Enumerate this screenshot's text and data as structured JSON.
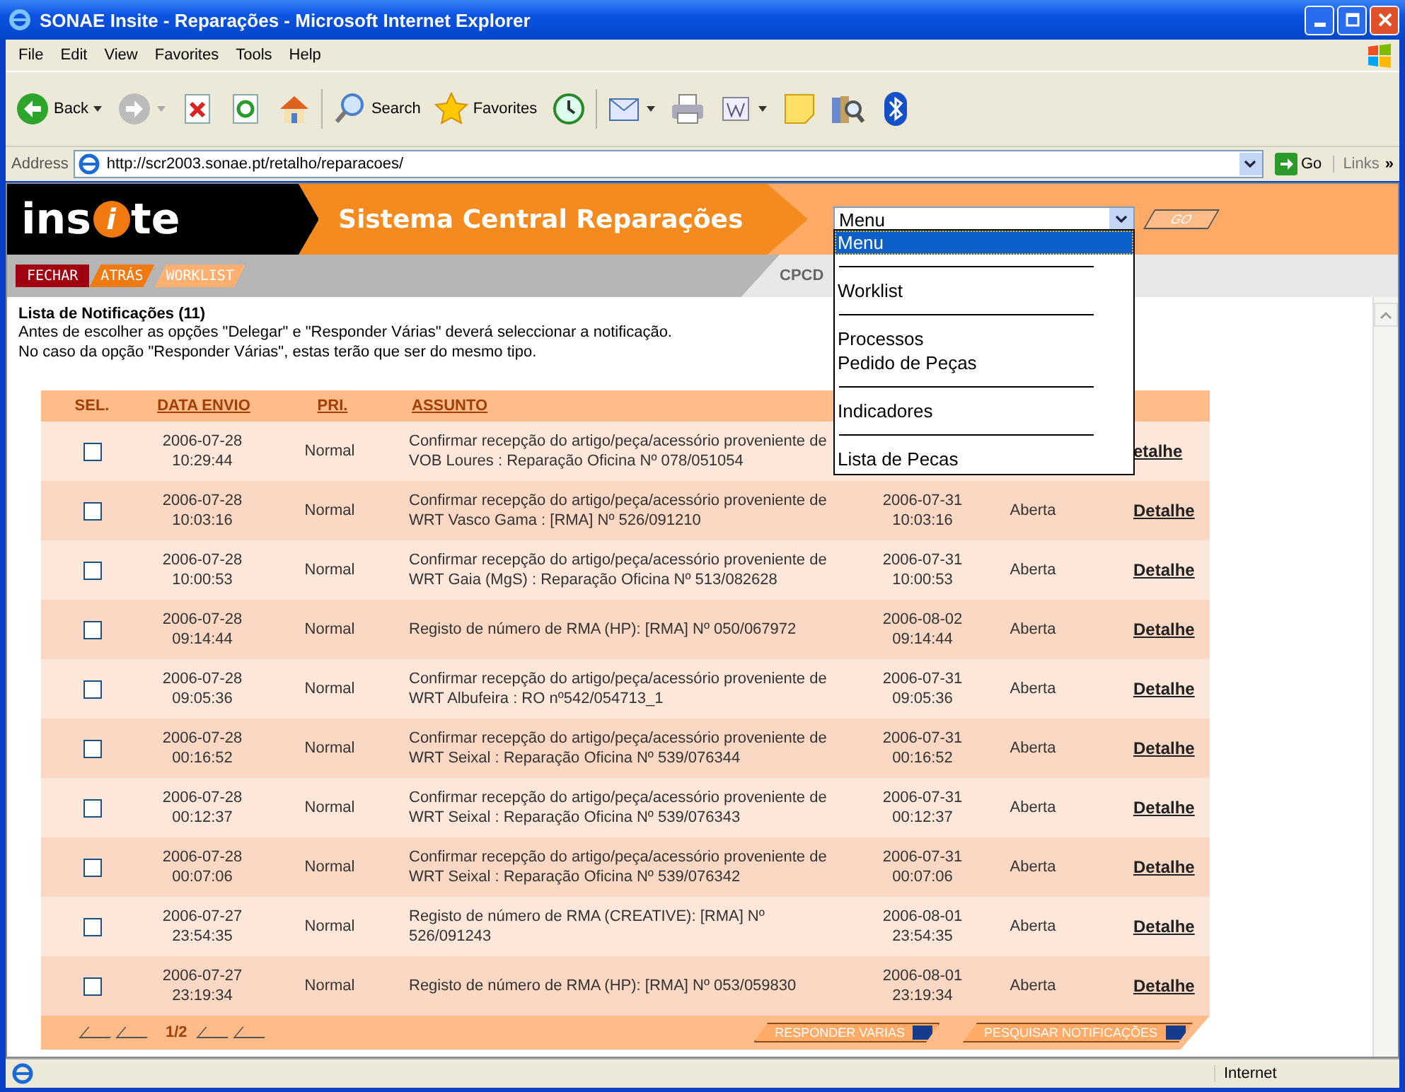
{
  "window": {
    "title": "SONAE Insite - Reparações - Microsoft Internet Explorer"
  },
  "menu_bar": [
    "File",
    "Edit",
    "View",
    "Favorites",
    "Tools",
    "Help"
  ],
  "toolbar": [
    {
      "kind": "back",
      "label": "Back"
    },
    {
      "kind": "forward"
    },
    {
      "kind": "stop"
    },
    {
      "kind": "refresh"
    },
    {
      "kind": "home"
    },
    {
      "kind": "search",
      "label": "Search"
    },
    {
      "kind": "favorites",
      "label": "Favorites"
    },
    {
      "kind": "history"
    },
    {
      "kind": "mail"
    },
    {
      "kind": "print"
    },
    {
      "kind": "word"
    },
    {
      "kind": "note"
    },
    {
      "kind": "research"
    },
    {
      "kind": "bluetooth"
    }
  ],
  "address_bar": {
    "label": "Address",
    "value": "http://scr2003.sonae.pt/retalho/reparacoes/",
    "go": "Go",
    "links": "Links",
    "more": "»"
  },
  "header": {
    "logo_start": "ins",
    "logo_mark": "i",
    "logo_end": "te",
    "title": "Sistema Central Reparações",
    "menu_select": "Menu",
    "go_button": "GO"
  },
  "nav_buttons": [
    {
      "label": "FECHAR",
      "color": "#a00010"
    },
    {
      "label": "ATRÁS",
      "color": "#f07a10"
    },
    {
      "label": "WORKLIST",
      "color": "#ffb070"
    }
  ],
  "user_code": "CPCD",
  "intro": {
    "title": "Lista de Notificações (11)",
    "lines": [
      "Antes de escolher as opções \"Delegar\" e \"Responder Várias\" deverá seleccionar a notificação.",
      "No caso da opção \"Responder Várias\", estas terão que ser do mesmo tipo."
    ]
  },
  "table": {
    "columns": [
      "SEL.",
      "DATA ENVIO",
      "PRI.",
      "ASSUNTO"
    ],
    "rows": [
      {
        "checked": false,
        "sent": [
          "2006-07-28",
          "10:29:44"
        ],
        "priority": "Normal",
        "subject": [
          "Confirmar recepção do artigo/peça/acessório proveniente de",
          "VOB Loures : Reparação Oficina Nº 078/051054"
        ],
        "link": "etalhe"
      },
      {
        "checked": false,
        "sent": [
          "2006-07-28",
          "10:03:16"
        ],
        "priority": "Normal",
        "subject": [
          "Confirmar recepção do artigo/peça/acessório proveniente de",
          "WRT Vasco Gama : [RMA] Nº 526/091210"
        ],
        "due": [
          "2006-07-31",
          "10:03:16"
        ],
        "status": "Aberta",
        "link": "Detalhe"
      },
      {
        "checked": false,
        "sent": [
          "2006-07-28",
          "10:00:53"
        ],
        "priority": "Normal",
        "subject": [
          "Confirmar recepção do artigo/peça/acessório proveniente de",
          "WRT Gaia (MgS) : Reparação Oficina Nº 513/082628"
        ],
        "due": [
          "2006-07-31",
          "10:00:53"
        ],
        "status": "Aberta",
        "link": "Detalhe"
      },
      {
        "checked": false,
        "sent": [
          "2006-07-28",
          "09:14:44"
        ],
        "priority": "Normal",
        "subject": [
          "Registo de número de RMA (HP): [RMA] Nº 050/067972"
        ],
        "due": [
          "2006-08-02",
          "09:14:44"
        ],
        "status": "Aberta",
        "link": "Detalhe"
      },
      {
        "checked": false,
        "sent": [
          "2006-07-28",
          "09:05:36"
        ],
        "priority": "Normal",
        "subject": [
          "Confirmar recepção do artigo/peça/acessório proveniente de",
          "WRT Albufeira : RO nº542/054713_1"
        ],
        "due": [
          "2006-07-31",
          "09:05:36"
        ],
        "status": "Aberta",
        "link": "Detalhe"
      },
      {
        "checked": false,
        "sent": [
          "2006-07-28",
          "00:16:52"
        ],
        "priority": "Normal",
        "subject": [
          "Confirmar recepção do artigo/peça/acessório proveniente de",
          "WRT Seixal : Reparação Oficina Nº 539/076344"
        ],
        "due": [
          "2006-07-31",
          "00:16:52"
        ],
        "status": "Aberta",
        "link": "Detalhe"
      },
      {
        "checked": false,
        "sent": [
          "2006-07-28",
          "00:12:37"
        ],
        "priority": "Normal",
        "subject": [
          "Confirmar recepção do artigo/peça/acessório proveniente de",
          "WRT Seixal : Reparação Oficina Nº 539/076343"
        ],
        "due": [
          "2006-07-31",
          "00:12:37"
        ],
        "status": "Aberta",
        "link": "Detalhe"
      },
      {
        "checked": false,
        "sent": [
          "2006-07-28",
          "00:07:06"
        ],
        "priority": "Normal",
        "subject": [
          "Confirmar recepção do artigo/peça/acessório proveniente de",
          "WRT Seixal : Reparação Oficina Nº 539/076342"
        ],
        "due": [
          "2006-07-31",
          "00:07:06"
        ],
        "status": "Aberta",
        "link": "Detalhe"
      },
      {
        "checked": false,
        "sent": [
          "2006-07-27",
          "23:54:35"
        ],
        "priority": "Normal",
        "subject": [
          "Registo de número de RMA (CREATIVE): [RMA] Nº",
          "526/091243"
        ],
        "due": [
          "2006-08-01",
          "23:54:35"
        ],
        "status": "Aberta",
        "link": "Detalhe"
      },
      {
        "checked": false,
        "sent": [
          "2006-07-27",
          "23:19:34"
        ],
        "priority": "Normal",
        "subject": [
          "Registo de número de RMA (HP): [RMA] Nº 053/059830"
        ],
        "due": [
          "2006-08-01",
          "23:19:34"
        ],
        "status": "Aberta",
        "link": "Detalhe"
      }
    ]
  },
  "pager": {
    "page": "1/2"
  },
  "footer_buttons": [
    "RESPONDER VARIAS",
    "PESQUISAR NOTIFICAÇÕES"
  ],
  "dropdown": [
    {
      "kind": "option",
      "label": "Menu",
      "selected": true
    },
    {
      "kind": "separator"
    },
    {
      "kind": "option",
      "label": "Worklist",
      "selected": false
    },
    {
      "kind": "separator"
    },
    {
      "kind": "option",
      "label": "Processos",
      "selected": false
    },
    {
      "kind": "option",
      "label": "Pedido de Peças",
      "selected": false
    },
    {
      "kind": "separator"
    },
    {
      "kind": "option",
      "label": "Indicadores",
      "selected": false
    },
    {
      "kind": "separator"
    },
    {
      "kind": "option",
      "label": "Lista de Pecas",
      "selected": false
    }
  ],
  "status_bar": {
    "zone": "Internet"
  }
}
